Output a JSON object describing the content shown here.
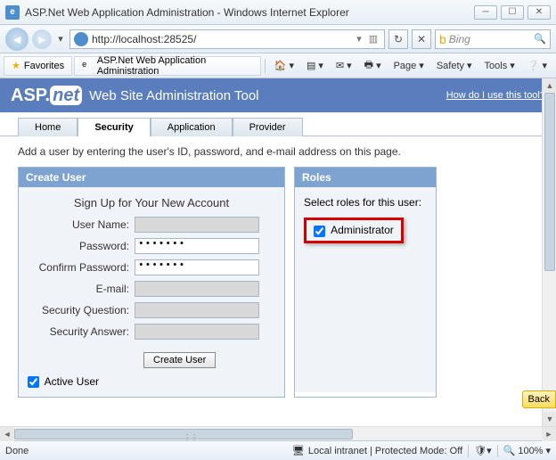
{
  "window": {
    "title": "ASP.Net Web Application Administration - Windows Internet Explorer"
  },
  "address": {
    "url": "http://localhost:28525/"
  },
  "search": {
    "provider": "Bing"
  },
  "favorites_btn": "Favorites",
  "tab_title": "ASP.Net Web Application Administration",
  "commandbar": {
    "page": "Page",
    "safety": "Safety",
    "tools": "Tools"
  },
  "banner": {
    "brand_asp": "ASP",
    "brand_net": "net",
    "title": "Web Site Administration Tool",
    "help_link": "How do I use this tool?"
  },
  "tabs": {
    "home": "Home",
    "security": "Security",
    "application": "Application",
    "provider": "Provider"
  },
  "page_desc": "Add a user by entering the user's ID, password, and e-mail address on this page.",
  "create_user": {
    "header": "Create User",
    "title": "Sign Up for Your New Account",
    "labels": {
      "username": "User Name:",
      "password": "Password:",
      "confirm": "Confirm Password:",
      "email": "E-mail:",
      "question": "Security Question:",
      "answer": "Security Answer:"
    },
    "password_mask": "•••••••",
    "button": "Create User",
    "active_user": "Active User"
  },
  "roles": {
    "header": "Roles",
    "prompt": "Select roles for this user:",
    "items": [
      "Administrator"
    ]
  },
  "back_btn": "Back",
  "status": {
    "done": "Done",
    "zone": "Local intranet | Protected Mode: Off",
    "zoom": "100%"
  }
}
